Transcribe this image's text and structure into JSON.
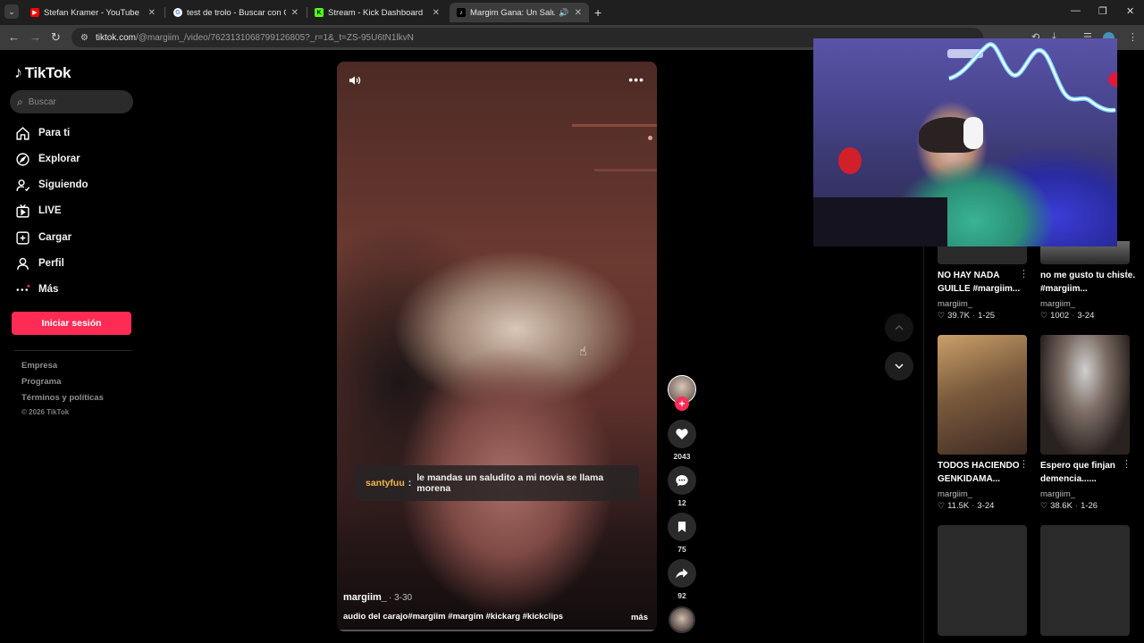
{
  "browser": {
    "tabs": [
      {
        "title": "Stefan Kramer - YouTube",
        "icon": "youtube-icon",
        "color": "#ff0000"
      },
      {
        "title": "test de trolo - Buscar con Goog",
        "icon": "google-icon",
        "color": "#4285f4"
      },
      {
        "title": "Stream - Kick Dashboard",
        "icon": "kick-icon",
        "color": "#53fc18"
      },
      {
        "title": "Margim Gana: Un Saludo a",
        "icon": "tiktok-icon",
        "color": "#ffffff"
      }
    ],
    "url_host": "tiktok.com",
    "url_path": "/@margiim_/video/7623131068799126805?_r=1&_t=ZS-95U6tN1lkvN"
  },
  "sidebar": {
    "brand": "TikTok",
    "search_placeholder": "Buscar",
    "nav": [
      {
        "label": "Para ti",
        "icon": "home-icon"
      },
      {
        "label": "Explorar",
        "icon": "compass-icon"
      },
      {
        "label": "Siguiendo",
        "icon": "following-icon"
      },
      {
        "label": "LIVE",
        "icon": "live-icon"
      },
      {
        "label": "Cargar",
        "icon": "upload-icon"
      },
      {
        "label": "Perfil",
        "icon": "profile-icon"
      },
      {
        "label": "Más",
        "icon": "more-icon"
      }
    ],
    "login_label": "Iniciar sesión",
    "footer_links": [
      "Empresa",
      "Programa",
      "Términos y políticas"
    ],
    "copyright": "© 2026 TikTok"
  },
  "video": {
    "chat_user": "santyfuu",
    "chat_colon": ":",
    "chat_message": "le mandas un saludito a mi novia se llama morena",
    "author": "margiim_",
    "date": "· 3-30",
    "caption": "audio del carajo#margiim #margim #kickarg #kickclips",
    "more_label": "más"
  },
  "actions": {
    "likes": "2043",
    "comments": "12",
    "saves": "75",
    "shares": "92"
  },
  "related": [
    {
      "title": "NO HAY NADA GUILLE #margiim...",
      "author": "margiim_",
      "likes": "39.7K",
      "date": "1-25"
    },
    {
      "title": "no me gusto tu chiste. #margiim...",
      "author": "margiim_",
      "likes": "1002",
      "date": "3-24"
    },
    {
      "title": "TODOS HACIENDO GENKIDAMA...",
      "author": "margiim_",
      "likes": "11.5K",
      "date": "3-24"
    },
    {
      "title": "Espero que finjan demencia......",
      "author": "margiim_",
      "likes": "38.6K",
      "date": "1-26"
    }
  ],
  "colors": {
    "accent": "#fe2c55",
    "chat_user": "#f0b84b",
    "background": "#000000"
  }
}
